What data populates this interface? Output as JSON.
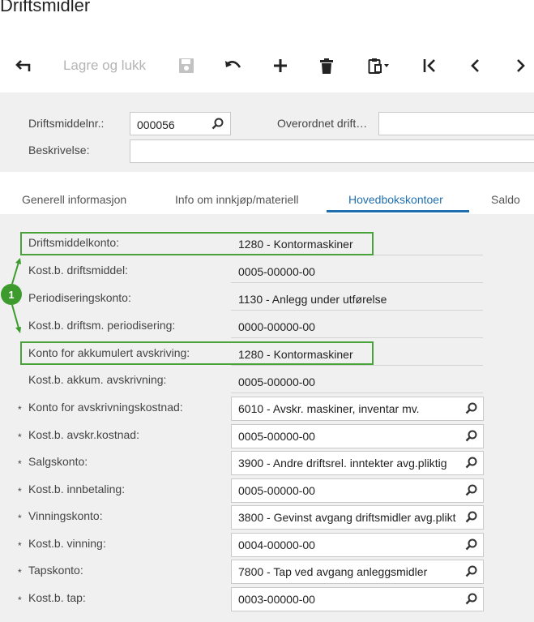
{
  "page": {
    "title": "Driftsmidler"
  },
  "toolbar": {
    "save_close_label": "Lagre og lukk",
    "icons": [
      "back-arrow-icon",
      "save-icon",
      "undo-icon",
      "plus-icon",
      "trash-icon",
      "clipboard-icon",
      "first-record-icon",
      "previous-icon",
      "next-icon"
    ]
  },
  "header": {
    "asset_no_label": "Driftsmiddelnr.:",
    "asset_no_value": "000056",
    "parent_label": "Overordnet drift…",
    "parent_value": "",
    "description_label": "Beskrivelse:",
    "description_value": ""
  },
  "tabs": [
    "Generell informasjon",
    "Info om innkjøp/materiell",
    "Hovedbokskontoer",
    "Saldo"
  ],
  "active_tab": "Hovedbokskontoer",
  "accounts": {
    "rows": [
      {
        "label": "Driftsmiddelkonto:",
        "value": "1280 - Kontormaskiner"
      },
      {
        "label": "Kost.b. driftsmiddel:",
        "value": "0005-00000-00"
      },
      {
        "label": "Periodiseringskonto:",
        "value": "1130 - Anlegg under utførelse"
      },
      {
        "label": "Kost.b. driftsm. periodisering:",
        "value": "0000-00000-00"
      },
      {
        "label": "Konto for akkumulert avskriving:",
        "value": "1280 - Kontormaskiner"
      },
      {
        "label": "Kost.b. akkum. avskrivning:",
        "value": "0005-00000-00"
      },
      {
        "label": "Konto for avskrivningskostnad:",
        "value": "6010 - Avskr. maskiner, inventar mv."
      },
      {
        "label": "Kost.b. avskr.kostnad:",
        "value": "0005-00000-00"
      },
      {
        "label": "Salgskonto:",
        "value": "3900 - Andre driftsrel. inntekter avg.pliktig"
      },
      {
        "label": "Kost.b. innbetaling:",
        "value": "0005-00000-00"
      },
      {
        "label": "Vinningskonto:",
        "value": "3800 - Gevinst avgang driftsmidler avg.plikt"
      },
      {
        "label": "Kost.b. vinning:",
        "value": "0004-00000-00"
      },
      {
        "label": "Tapskonto:",
        "value": "7800 - Tap ved avgang anleggsmidler"
      },
      {
        "label": "Kost.b. tap:",
        "value": "0003-00000-00"
      }
    ]
  },
  "callout": {
    "number": "1",
    "color": "#3c9b2c"
  },
  "colors": {
    "accent": "#1f6fb0",
    "highlight": "#4aa33a"
  }
}
